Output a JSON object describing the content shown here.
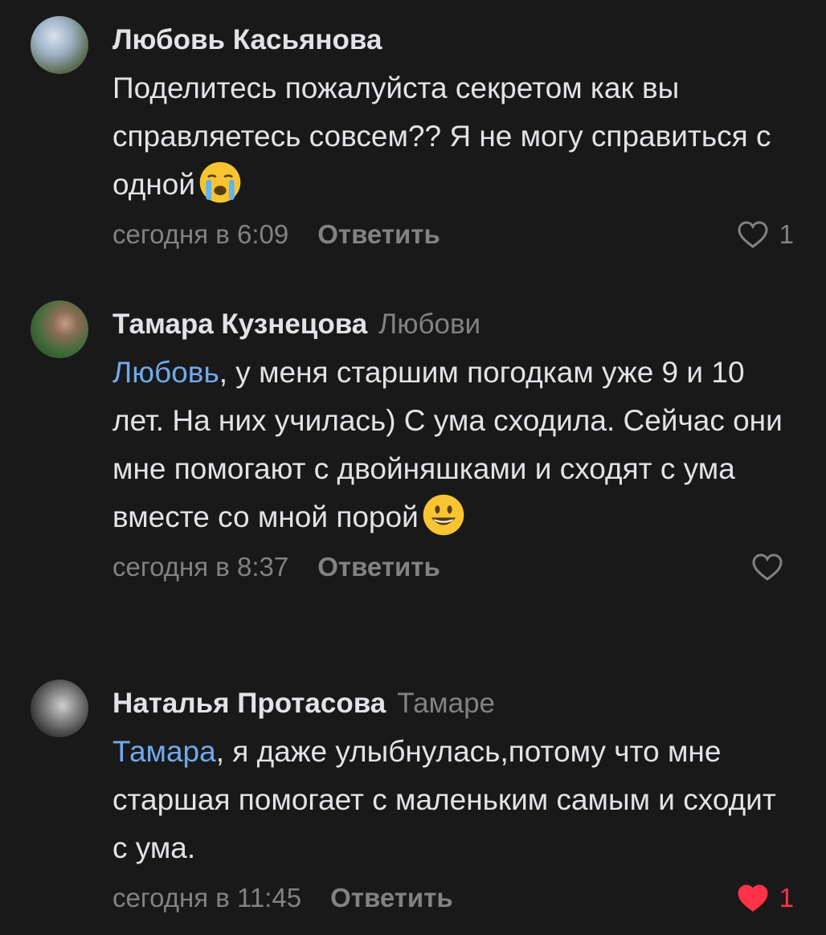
{
  "colors": {
    "background": "#19191a",
    "text": "#e1e3e6",
    "muted": "#828282",
    "mention": "#71aaeb",
    "liked": "#ff3347"
  },
  "comments": [
    {
      "author": "Любовь Касьянова",
      "reply_to": "",
      "mention": "",
      "text": "Поделитесь пожалуйста секретом как вы справляетесь совсем?? Я не могу справиться с одной",
      "emoji": "crying-face-emoji",
      "time": "сегодня в 6:09",
      "reply_label": "Ответить",
      "likes": "1",
      "liked": false
    },
    {
      "author": "Тамара Кузнецова",
      "reply_to": "Любови",
      "mention": "Любовь",
      "text": ", у меня старшим погодкам уже 9 и 10 лет. На них училась) С ума сходила. Сейчас они мне помогают с двойняшками и сходят с ума вместе со мной порой",
      "emoji": "smiling-face-emoji",
      "time": "сегодня в 8:37",
      "reply_label": "Ответить",
      "likes": "",
      "liked": false
    },
    {
      "author": "Наталья Протасова",
      "reply_to": "Тамаре",
      "mention": "Тамара",
      "text": ", я даже улыбнулась,потому что мне старшая помогает с маленьким самым и сходит с ума.",
      "emoji": "",
      "time": "сегодня в 11:45",
      "reply_label": "Ответить",
      "likes": "1",
      "liked": true
    }
  ]
}
